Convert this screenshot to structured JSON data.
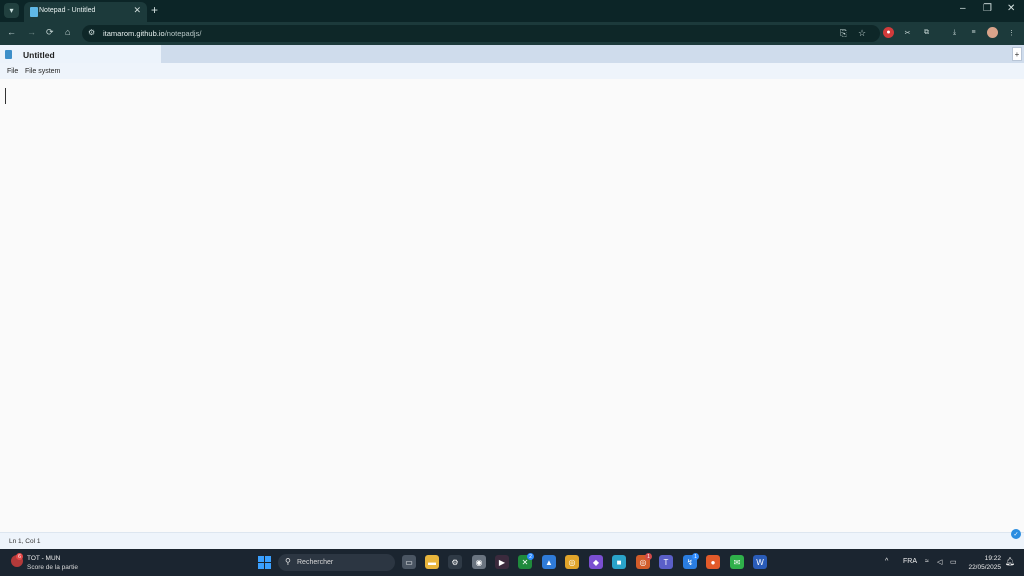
{
  "browser": {
    "tab_title": "Notepad - Untitled",
    "tab_close": "✕",
    "new_tab": "+",
    "url_host": "itamarom.github.io",
    "url_path": "/notepadjs/",
    "window_controls": {
      "minimize": "–",
      "restore": "❐",
      "close": "✕"
    },
    "nav": {
      "back": "←",
      "forward": "→",
      "reload": "⟳",
      "home": "⌂"
    }
  },
  "app": {
    "doc_title": "Untitled",
    "add_button": "+",
    "menu": [
      "File",
      "File system"
    ],
    "status": "Ln 1, Col 1"
  },
  "taskbar": {
    "weather_title": "TOT - MUN",
    "weather_subtitle": "Score de la partie",
    "weather_badge": "6",
    "search_placeholder": "Rechercher",
    "language": "FRA",
    "time": "19:22",
    "date": "22/05/2025",
    "badges": {
      "xbox": "2",
      "chrome": "1",
      "messenger": "1"
    }
  },
  "colors": {
    "chrome_bg": "#1c3a3b",
    "title_band": "#cfdcec",
    "accent": "#2b8de0",
    "taskbar": "#1b2530"
  }
}
